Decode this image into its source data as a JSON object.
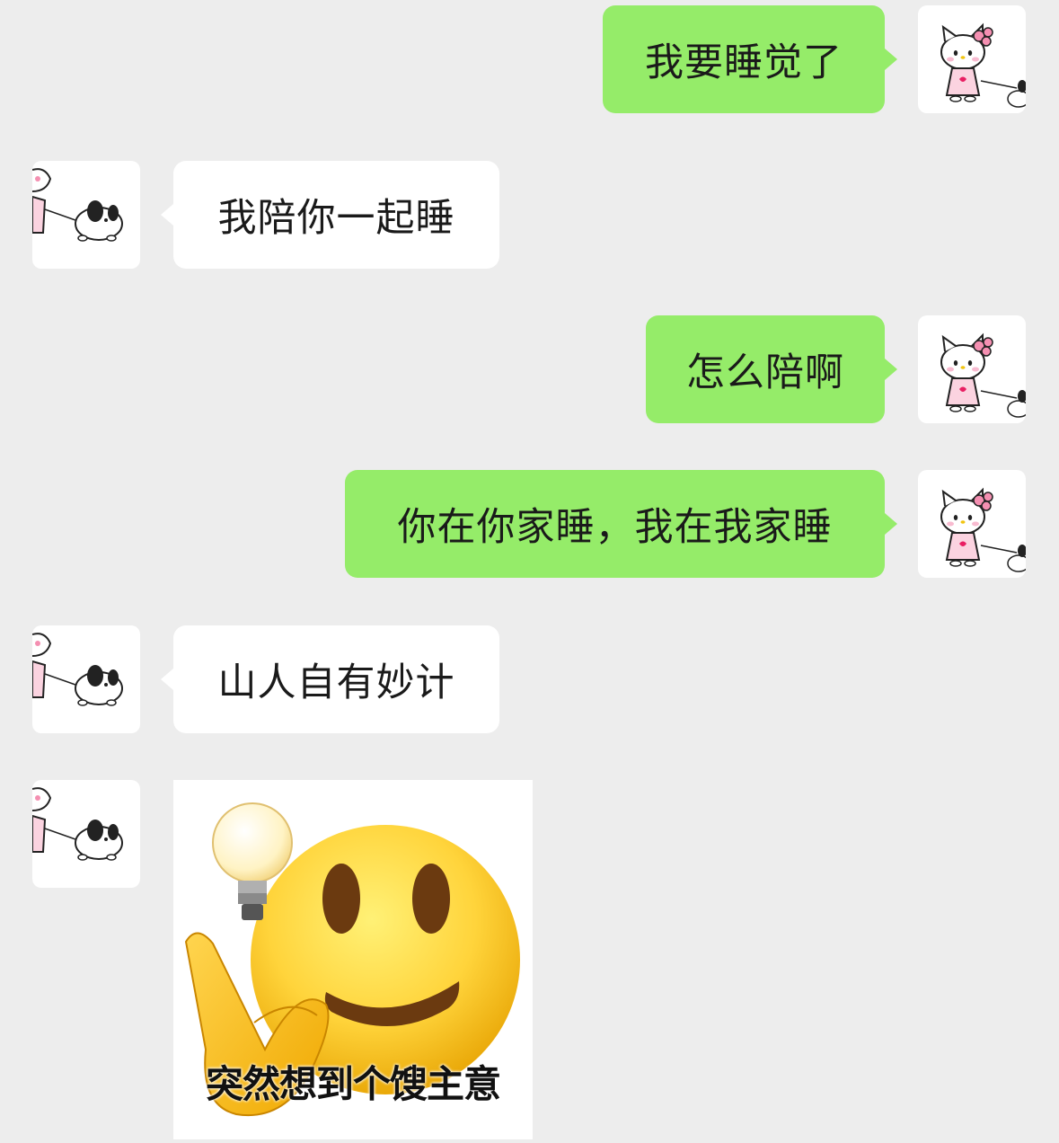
{
  "chat": {
    "messages": [
      {
        "direction": "out",
        "type": "text",
        "text": "我要睡觉了",
        "avatar": "hello-kitty-avatar-icon"
      },
      {
        "direction": "in",
        "type": "text",
        "text": "我陪你一起睡",
        "avatar": "kitty-and-puppy-avatar-icon"
      },
      {
        "direction": "out",
        "type": "text",
        "text": "怎么陪啊",
        "avatar": "hello-kitty-avatar-icon"
      },
      {
        "direction": "out",
        "type": "text",
        "text": "你在你家睡，我在我家睡",
        "avatar": "hello-kitty-avatar-icon"
      },
      {
        "direction": "in",
        "type": "text",
        "text": "山人自有妙计",
        "avatar": "kitty-and-puppy-avatar-icon"
      },
      {
        "direction": "in",
        "type": "sticker",
        "sticker": "lightbulb-thinking-smiley-sticker",
        "caption": "突然想到个馊主意",
        "avatar": "kitty-and-puppy-avatar-icon"
      }
    ]
  },
  "colors": {
    "background": "#ededed",
    "outgoing_bubble": "#95ec69",
    "incoming_bubble": "#ffffff"
  }
}
